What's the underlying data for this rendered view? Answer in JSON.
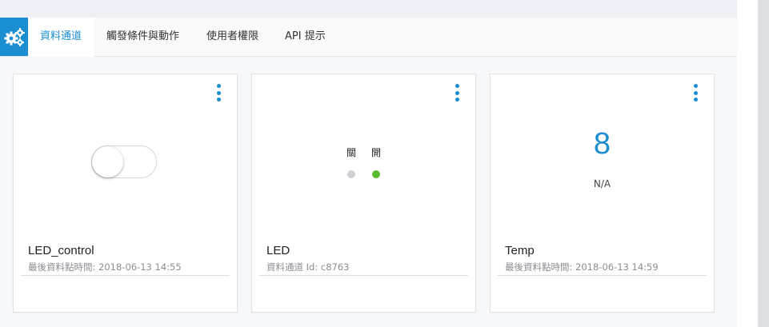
{
  "tabs": [
    {
      "label": "資料通道",
      "active": true
    },
    {
      "label": "觸發條件與動作",
      "active": false
    },
    {
      "label": "使用者權限",
      "active": false
    },
    {
      "label": "API 提示",
      "active": false
    }
  ],
  "cards": [
    {
      "title": "LED_control",
      "subtitle": "最後資料點時間: 2018-06-13 14:55",
      "widget": "switch",
      "switch_on": false
    },
    {
      "title": "LED",
      "subtitle": "資料通道 Id: c8763",
      "widget": "indicator",
      "off_label": "關",
      "on_label": "開",
      "off_color": "#cfd1d4",
      "on_color": "#5dbb2b"
    },
    {
      "title": "Temp",
      "subtitle": "最後資料點時間: 2018-06-13 14:59",
      "widget": "value",
      "value": "8",
      "unit": "N/A"
    }
  ],
  "colors": {
    "accent": "#1a8ed0"
  }
}
